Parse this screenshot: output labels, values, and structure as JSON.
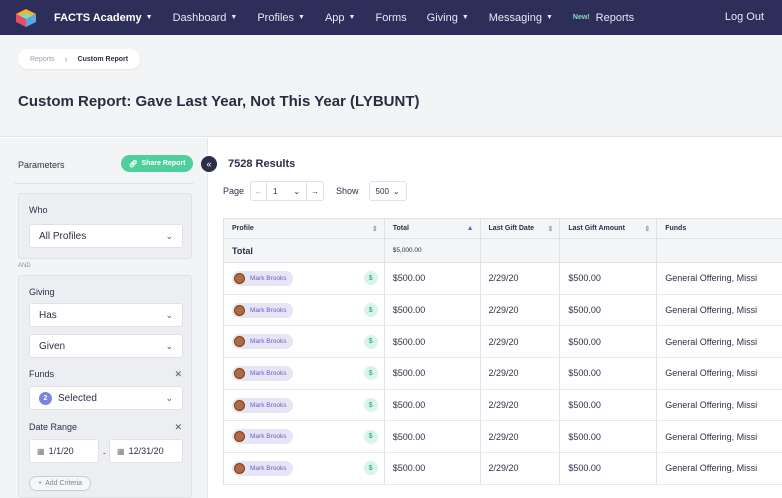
{
  "nav": {
    "brand": "FACTS Academy",
    "items": [
      {
        "label": "Dashboard",
        "caret": true
      },
      {
        "label": "Profiles",
        "caret": true
      },
      {
        "label": "App",
        "caret": true
      },
      {
        "label": "Forms",
        "caret": false
      },
      {
        "label": "Giving",
        "caret": true
      },
      {
        "label": "Messaging",
        "caret": true
      }
    ],
    "new_tag": "New!",
    "reports": "Reports",
    "logout": "Log Out"
  },
  "breadcrumb": {
    "parent": "Reports",
    "current": "Custom Report"
  },
  "page_title": "Custom Report: Gave Last Year, Not This Year (LYBUNT)",
  "parameters": {
    "label": "Parameters",
    "share_button": "Share Report",
    "who": {
      "label": "Who",
      "value": "All Profiles"
    },
    "and_label": "AND",
    "giving": {
      "label": "Giving",
      "has_value": "Has",
      "given_value": "Given",
      "funds_label": "Funds",
      "funds_count": "2",
      "funds_value": "Selected",
      "date_range_label": "Date Range",
      "date_from": "1/1/20",
      "date_to": "12/31/20",
      "dash": "-",
      "add_criteria": "Add Criteria"
    }
  },
  "results": {
    "title": "7528 Results",
    "page_label": "Page",
    "page_value": "1",
    "show_label": "Show",
    "show_value": "500"
  },
  "table": {
    "columns": [
      "Profile",
      "Total",
      "Last Gift Date",
      "Last Gift Amount",
      "Funds"
    ],
    "total_label": "Total",
    "total_value": "$5,000.00",
    "rows": [
      {
        "name": "Mark Brooks",
        "total": "$500.00",
        "date": "2/29/20",
        "amount": "$500.00",
        "funds": "General Offering, Missi"
      },
      {
        "name": "Mark Brooks",
        "total": "$500.00",
        "date": "2/29/20",
        "amount": "$500.00",
        "funds": "General Offering, Missi"
      },
      {
        "name": "Mark Brooks",
        "total": "$500.00",
        "date": "2/29/20",
        "amount": "$500.00",
        "funds": "General Offering, Missi"
      },
      {
        "name": "Mark Brooks",
        "total": "$500.00",
        "date": "2/29/20",
        "amount": "$500.00",
        "funds": "General Offering, Missi"
      },
      {
        "name": "Mark Brooks",
        "total": "$500.00",
        "date": "2/29/20",
        "amount": "$500.00",
        "funds": "General Offering, Missi"
      },
      {
        "name": "Mark Brooks",
        "total": "$500.00",
        "date": "2/29/20",
        "amount": "$500.00",
        "funds": "General Offering, Missi"
      },
      {
        "name": "Mark Brooks",
        "total": "$500.00",
        "date": "2/29/20",
        "amount": "$500.00",
        "funds": "General Offering, Missi"
      }
    ]
  },
  "icons": {
    "logo": "facts-logo-icon",
    "dollar_symbol": "$"
  }
}
